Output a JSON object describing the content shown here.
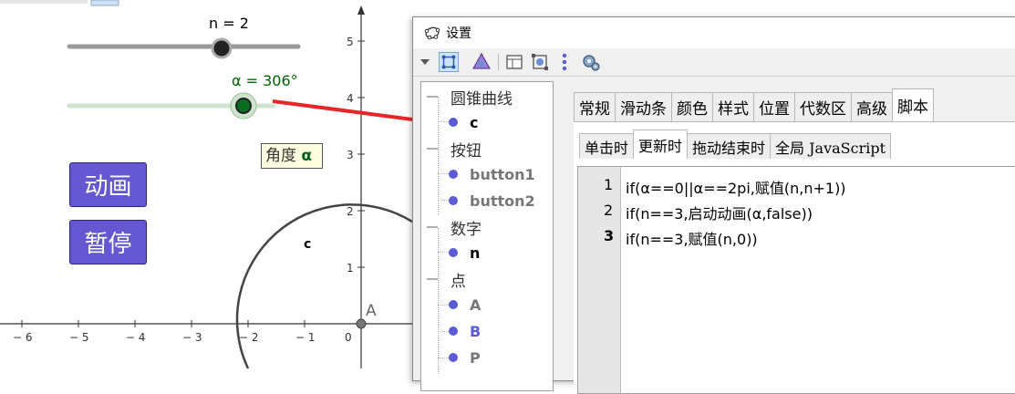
{
  "sliders": {
    "n": {
      "label": "n = 2",
      "value": 2,
      "min": 0,
      "max": 3,
      "color": "#000000"
    },
    "alpha": {
      "label": "α = 306°",
      "value_deg": 306,
      "min": 0,
      "max": 360,
      "color": "#006600"
    }
  },
  "angle_caption": {
    "prefix": "角度",
    "symbol": "α"
  },
  "buttons": {
    "animate": "动画",
    "pause": "暂停"
  },
  "graph": {
    "x_ticks": [
      "-6",
      "-5",
      "-4",
      "-3",
      "-2",
      "-1",
      "0"
    ],
    "y_ticks": [
      "5",
      "4",
      "3",
      "2",
      "1"
    ],
    "circle_label": "c",
    "point_label": "A"
  },
  "dialog": {
    "title": "设置",
    "toolbar_icons": [
      "menu-arrow-icon",
      "graphics-icon",
      "algebra-icon",
      "layout-icon",
      "objects-icon",
      "more-icon",
      "advanced-icon"
    ],
    "tree": [
      {
        "category": "圆锥曲线",
        "items": [
          "c"
        ]
      },
      {
        "category": "按钮",
        "items": [
          "button1",
          "button2"
        ]
      },
      {
        "category": "数字",
        "items": [
          "n"
        ]
      },
      {
        "category": "点",
        "items": [
          "A",
          "B",
          "P"
        ]
      }
    ],
    "tabs": [
      "常规",
      "滑动条",
      "颜色",
      "样式",
      "位置",
      "代数区",
      "高级",
      "脚本"
    ],
    "active_tab": "脚本",
    "subtabs": [
      "单击时",
      "更新时",
      "拖动结束时",
      "全局 JavaScript"
    ],
    "active_subtab": "更新时",
    "script_lines": [
      {
        "num": "1",
        "code": "if(α==0||α==2pi,赋值(n,n+1))"
      },
      {
        "num": "2",
        "code": "if(n==3,启动动画(α,false))"
      },
      {
        "num": "3",
        "code": "if(n==3,赋值(n,0))"
      }
    ]
  },
  "colors": {
    "button_fill": "#6557d2",
    "annotation_arrow": "#e8262a",
    "tree_dot": "#5b5bd6",
    "slider_track": "#999999",
    "alpha_track": "#cfe3cf"
  }
}
